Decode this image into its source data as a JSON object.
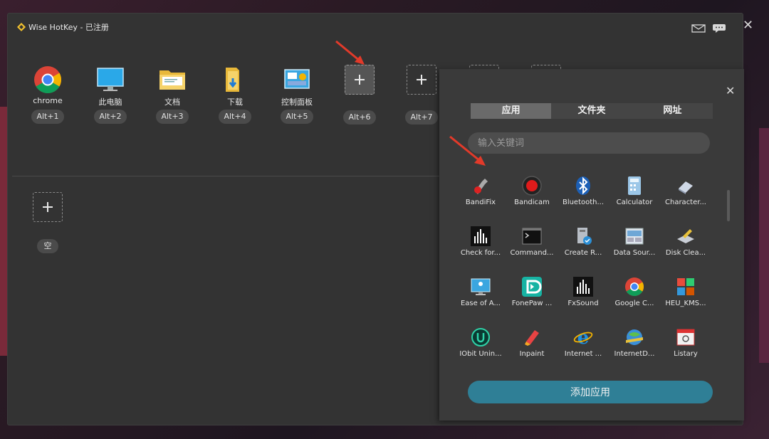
{
  "window": {
    "title": "Wise HotKey - 已注册",
    "icons": {
      "logo": "wise-hotkey-logo",
      "mail": "envelope-icon",
      "feedback": "chat-bubble-icon",
      "close": "close-icon"
    }
  },
  "hotkeys": [
    {
      "label": "chrome",
      "key": "Alt+1",
      "icon": "chrome-icon"
    },
    {
      "label": "此电脑",
      "key": "Alt+2",
      "icon": "monitor-icon"
    },
    {
      "label": "文档",
      "key": "Alt+3",
      "icon": "folder-icon"
    },
    {
      "label": "下载",
      "key": "Alt+4",
      "icon": "download-folder-icon"
    },
    {
      "label": "控制面板",
      "key": "Alt+5",
      "icon": "control-panel-icon"
    },
    {
      "label": "",
      "key": "Alt+6",
      "icon": "plus-icon"
    },
    {
      "label": "",
      "key": "Alt+7",
      "icon": "plus-icon"
    }
  ],
  "second_row": {
    "key": "空",
    "icon": "plus-icon"
  },
  "panel": {
    "tabs": [
      "应用",
      "文件夹",
      "网址"
    ],
    "active_tab": "应用",
    "search_placeholder": "输入关键词",
    "apps": [
      {
        "name": "BandiFix",
        "icon": "bandifix-icon"
      },
      {
        "name": "Bandicam",
        "icon": "bandicam-icon"
      },
      {
        "name": "Bluetooth...",
        "icon": "bluetooth-icon"
      },
      {
        "name": "Calculator",
        "icon": "calculator-icon"
      },
      {
        "name": "Character...",
        "icon": "character-map-icon"
      },
      {
        "name": "Check for...",
        "icon": "check-for-updates-icon"
      },
      {
        "name": "Command...",
        "icon": "command-prompt-icon"
      },
      {
        "name": "Create R...",
        "icon": "create-recovery-icon"
      },
      {
        "name": "Data Sour...",
        "icon": "data-sources-icon"
      },
      {
        "name": "Disk Clea...",
        "icon": "disk-cleanup-icon"
      },
      {
        "name": "Ease of A...",
        "icon": "ease-of-access-icon"
      },
      {
        "name": "FonePaw ...",
        "icon": "fonepaw-icon"
      },
      {
        "name": "FxSound",
        "icon": "fxsound-icon"
      },
      {
        "name": "Google C...",
        "icon": "google-chrome-icon"
      },
      {
        "name": "HEU_KMS...",
        "icon": "heu-kms-icon"
      },
      {
        "name": "IObit Unin...",
        "icon": "iobit-uninstaller-icon"
      },
      {
        "name": "Inpaint",
        "icon": "inpaint-icon"
      },
      {
        "name": "Internet ...",
        "icon": "internet-explorer-icon"
      },
      {
        "name": "InternetD...",
        "icon": "internet-download-icon"
      },
      {
        "name": "Listary",
        "icon": "listary-icon"
      }
    ],
    "add_button": "添加应用"
  },
  "colors": {
    "window_bg": "#333333",
    "accent": "#2f7f96",
    "arrow": "#e23a2a"
  }
}
